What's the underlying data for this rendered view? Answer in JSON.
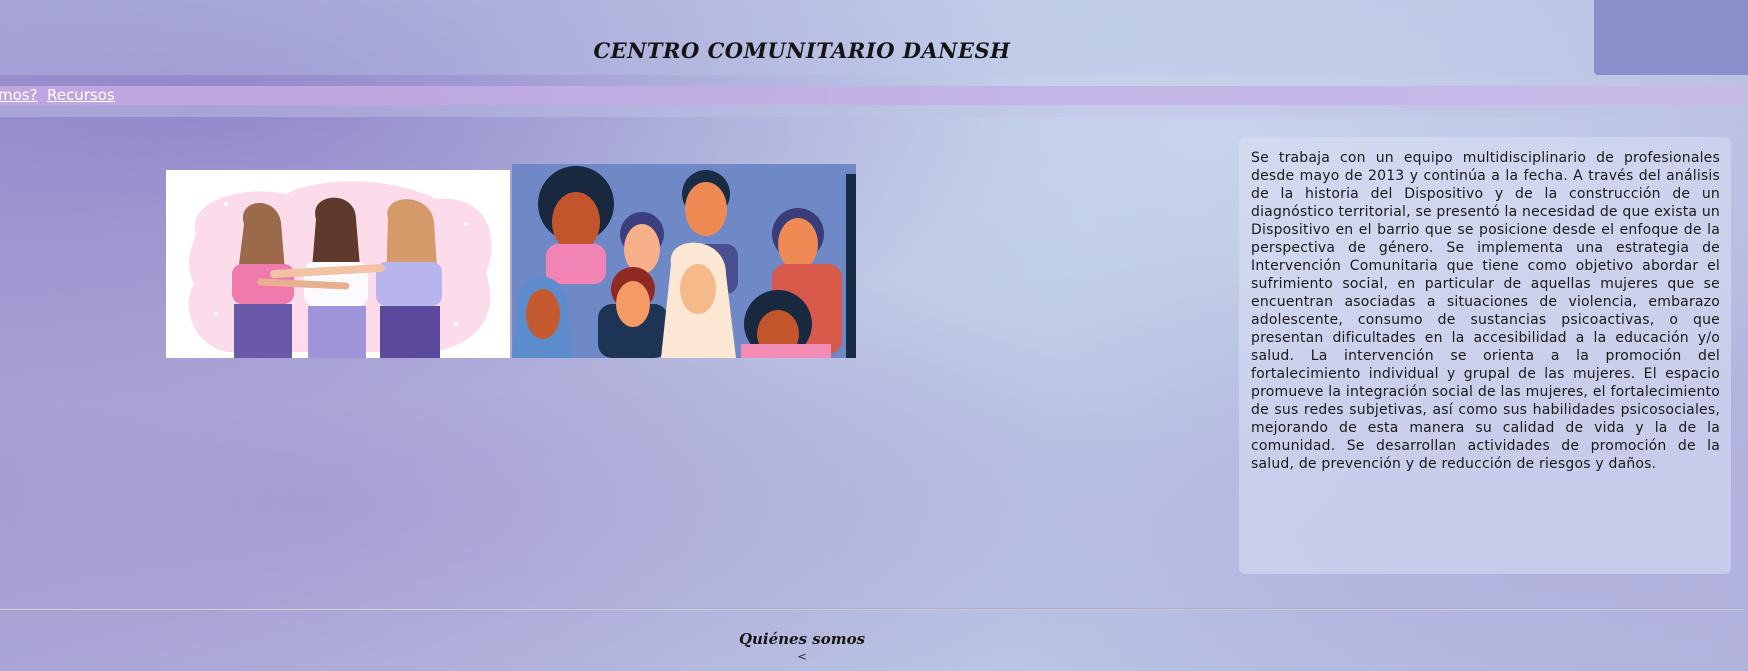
{
  "header": {
    "site_title": "CENTRO COMUNITARIO DANESH",
    "corner_color": "#8b8fcc"
  },
  "nav": {
    "items": [
      {
        "label": "mos?"
      },
      {
        "label": "Recursos"
      }
    ]
  },
  "main": {
    "hero_images": [
      {
        "icon": "women-embracing-illustration"
      },
      {
        "icon": "diverse-women-faces-illustration"
      }
    ],
    "description": "Se trabaja con un equipo multidisciplinario de profesionales desde mayo de 2013 y continúa a la fecha. A través del análisis de la historia del Dispositivo y de la construcción de un diagnóstico territorial, se presentó la necesidad de que exista un Dispositivo en el barrio que se posicione desde el enfoque de la perspectiva de género. Se implementa una estrategia de Intervención Comunitaria que tiene como objetivo abordar el sufrimiento social, en particular de aquellas mujeres que se encuentran asociadas a situaciones de violencia, embarazo adolescente, consumo de sustancias psicoactivas, o que presentan dificultades en la accesibilidad a la educación y/o salud. La intervención se orienta a la promoción del fortalecimiento individual y grupal de las mujeres. El espacio promueve la integración social de las mujeres, el fortalecimiento de sus redes subjetivas, así como sus habilidades psicosociales, mejorando de esta manera su calidad de vida y la de la comunidad. Se desarrollan actividades de promoción de la salud, de prevención y de reducción de riesgos y daños."
  },
  "footer": {
    "title": "Quiénes somos",
    "glyph": "<"
  }
}
